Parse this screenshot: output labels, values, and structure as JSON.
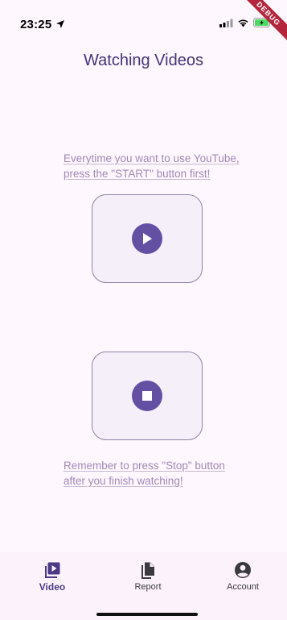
{
  "status_bar": {
    "time": "23:25",
    "debug_label": "DEBUG"
  },
  "page": {
    "title": "Watching Videos"
  },
  "start_section": {
    "instruction_lines": [
      "Everytime you want to use YouTube,",
      "press the \"START\" button first!"
    ],
    "button_icon": "play-icon"
  },
  "stop_section": {
    "button_icon": "stop-icon",
    "instruction_lines": [
      "Remember to press \"Stop\" button",
      "after you finish watching!"
    ]
  },
  "bottom_nav": {
    "items": [
      {
        "label": "Video",
        "icon": "video-library-icon",
        "active": true
      },
      {
        "label": "Report",
        "icon": "report-icon",
        "active": false
      },
      {
        "label": "Account",
        "icon": "account-icon",
        "active": false
      }
    ]
  },
  "colors": {
    "background": "#fef7fd",
    "title": "#45347a",
    "accent": "#6450a3",
    "instruction_text": "#9e8ab7",
    "button_border": "#8f84a2",
    "debug_banner": "#b4263c"
  }
}
